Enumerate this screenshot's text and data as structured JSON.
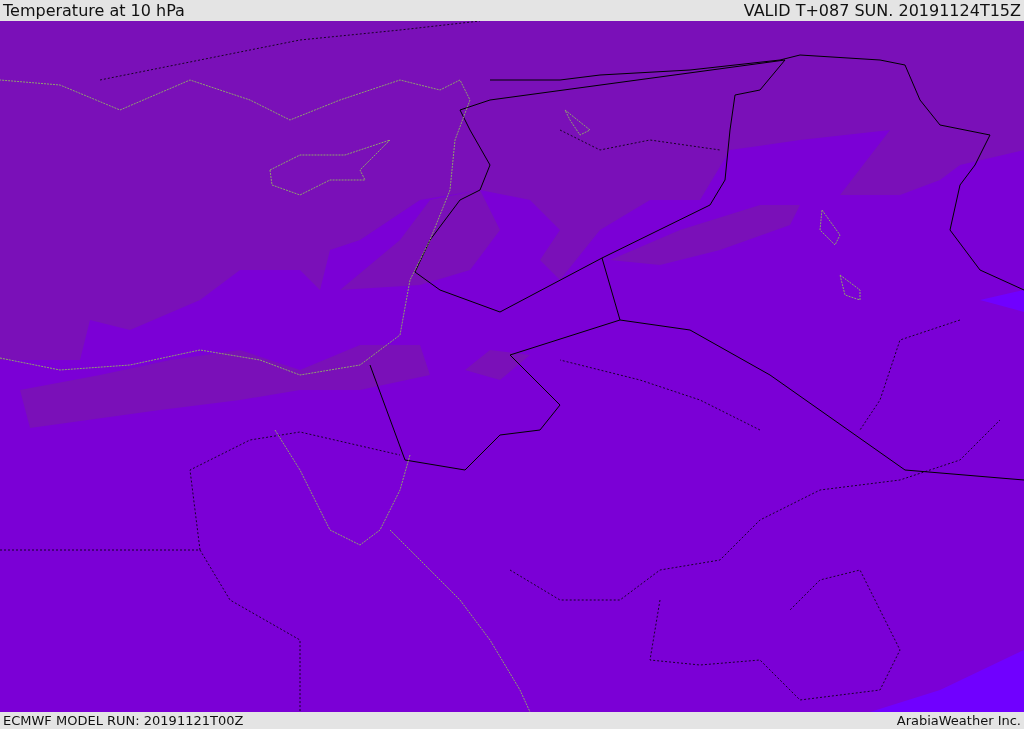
{
  "header": {
    "title": "Temperature at 10 hPa",
    "valid": "VALID T+087 SUN. 20191124T15Z"
  },
  "footer": {
    "model_run": "ECMWF MODEL RUN: 20191121T00Z",
    "credit": "ArabiaWeather Inc."
  }
}
